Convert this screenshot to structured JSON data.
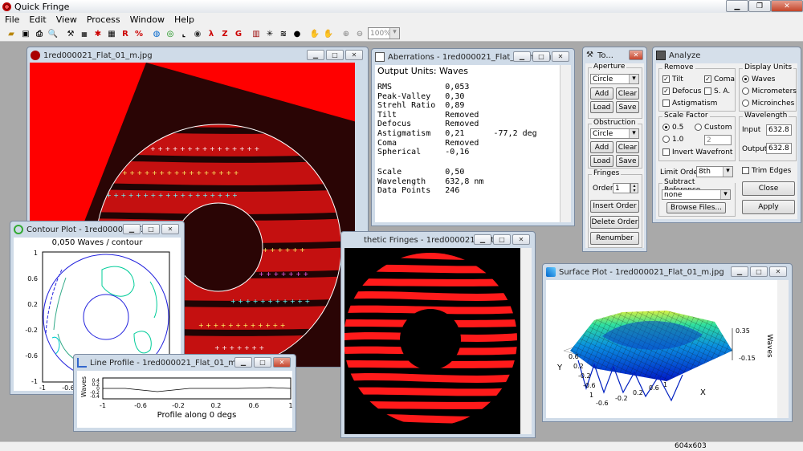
{
  "app": {
    "title": "Quick Fringe",
    "icon": "quick-fringe-app-icon"
  },
  "menu": [
    "File",
    "Edit",
    "View",
    "Process",
    "Window",
    "Help"
  ],
  "toolbar": {
    "zoom": "100%"
  },
  "status": {
    "size": "604x603"
  },
  "interferogram": {
    "title": "1red000021_Flat_01_m.jpg",
    "colors": {
      "background": "#ff0000",
      "fringe": "#c51212",
      "dark": "#1b0404"
    }
  },
  "aberrations": {
    "title": "Aberrations - 1red000021_Flat_01_m.jpg",
    "header": "Output Units: Waves",
    "rows": [
      {
        "name": "RMS",
        "value": "0,053",
        "extra": ""
      },
      {
        "name": "Peak-Valley",
        "value": "0,30",
        "extra": ""
      },
      {
        "name": "Strehl Ratio",
        "value": "0,89",
        "extra": ""
      },
      {
        "name": "Tilt",
        "value": "Removed",
        "extra": ""
      },
      {
        "name": "Defocus",
        "value": "Removed",
        "extra": ""
      },
      {
        "name": "Astigmatism",
        "value": "0,21",
        "extra": "-77,2 deg"
      },
      {
        "name": "Coma",
        "value": "Removed",
        "extra": ""
      },
      {
        "name": "Spherical",
        "value": "-0,16",
        "extra": ""
      }
    ],
    "footer": [
      {
        "name": "Scale",
        "value": "0,50"
      },
      {
        "name": "Wavelength",
        "value": "632,8 nm"
      },
      {
        "name": "Data Points",
        "value": "246"
      }
    ]
  },
  "tools": {
    "title": "To...",
    "aperture": {
      "label": "Aperture",
      "shape": "Circle",
      "add": "Add",
      "clear": "Clear",
      "load": "Load",
      "save": "Save"
    },
    "obstruction": {
      "label": "Obstruction",
      "shape": "Circle",
      "add": "Add",
      "clear": "Clear",
      "load": "Load",
      "save": "Save"
    },
    "fringes": {
      "label": "Fringes",
      "order_label": "Order",
      "order": "1",
      "insert": "Insert Order",
      "delete": "Delete Order",
      "renumber": "Renumber"
    }
  },
  "analyze": {
    "title": "Analyze",
    "remove": {
      "label": "Remove",
      "tilt": "Tilt",
      "coma": "Coma",
      "defocus": "Defocus",
      "sa": "S. A.",
      "astig": "Astigmatism"
    },
    "units": {
      "label": "Display Units",
      "waves": "Waves",
      "micrometers": "Micrometers",
      "microinches": "Microinches"
    },
    "scale": {
      "label": "Scale Factor",
      "opt1": "0.5",
      "custom": "Custom",
      "opt2": "1.0",
      "custom_value": "2",
      "invert": "Invert Wavefront"
    },
    "wavelength": {
      "label": "Wavelength",
      "input_label": "Input",
      "input": "632.8",
      "output_label": "Output",
      "output": "632.8"
    },
    "limit_label": "Limit Order",
    "limit": "8th",
    "trim": "Trim Edges",
    "subtract": {
      "label": "Subtract Reference",
      "value": "none",
      "browse": "Browse Files..."
    },
    "close": "Close",
    "apply": "Apply"
  },
  "contour": {
    "title": "Contour Plot - 1red000021_F...",
    "subtitle": "0,050 Waves / contour",
    "yticks": [
      "1",
      "0.6",
      "0.2",
      "-0.2",
      "-0.6",
      "-1"
    ],
    "xticks": [
      "-1",
      "-0.6"
    ]
  },
  "lineprofile": {
    "title": "Line Profile - 1red000021_Flat_01_m.jpg",
    "ylabel": "Waves",
    "yticks": [
      "0.4",
      "0.2",
      "0",
      "-0.2",
      "-0.4"
    ],
    "xticks": [
      "-1",
      "-0.6",
      "-0.2",
      "0.2",
      "0.6",
      "1"
    ],
    "xlabel": "Profile along 0 degs"
  },
  "synthetic": {
    "title": "thetic Fringes - 1red000021_Flat..."
  },
  "surface": {
    "title": "Surface Plot - 1red000021_Flat_01_m.jpg",
    "zlabel": "Waves",
    "zticks": [
      "0.35",
      "-0.15"
    ],
    "ylabel": "Y",
    "xlabel": "X",
    "yticks": [
      "0.6",
      "0.2",
      "-0.2",
      "-0.6",
      "1"
    ],
    "xticks": [
      "-0.6",
      "-0.2",
      "0.2",
      "0.6",
      "1"
    ]
  }
}
